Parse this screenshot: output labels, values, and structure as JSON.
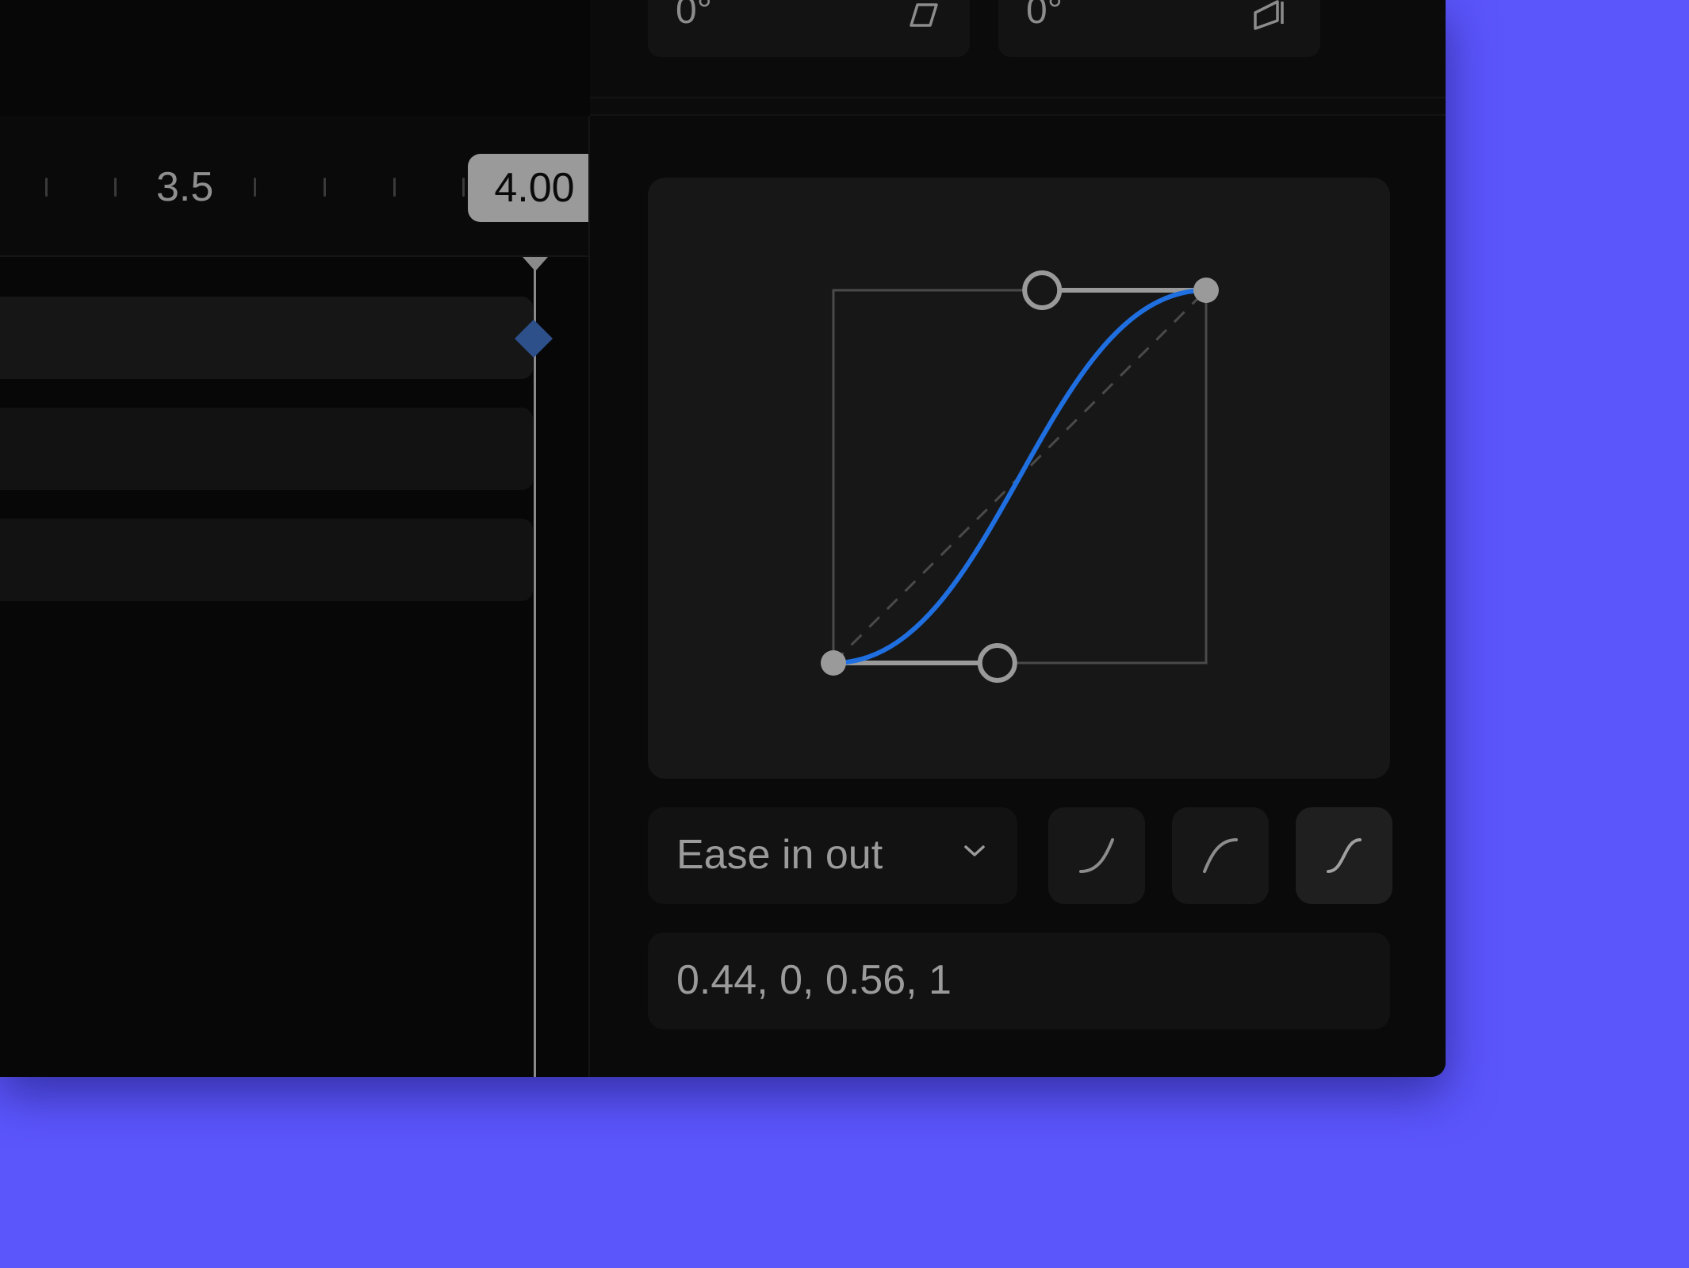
{
  "transform_fields": [
    {
      "value": "0°",
      "icon": "skew-icon"
    },
    {
      "value": "0°",
      "icon": "perspective-icon"
    }
  ],
  "timeline": {
    "ruler_label": "3.5",
    "current_time": "4.00"
  },
  "easing": {
    "preset_label": "Ease in out",
    "bezier_values": "0.44, 0, 0.56, 1",
    "bezier": [
      0.44,
      0,
      0.56,
      1
    ],
    "curve_color": "#1f6fe0",
    "presets": [
      {
        "icon": "ease-in-icon",
        "active": false
      },
      {
        "icon": "ease-out-icon",
        "active": false
      },
      {
        "icon": "ease-in-out-icon",
        "active": true
      }
    ]
  }
}
